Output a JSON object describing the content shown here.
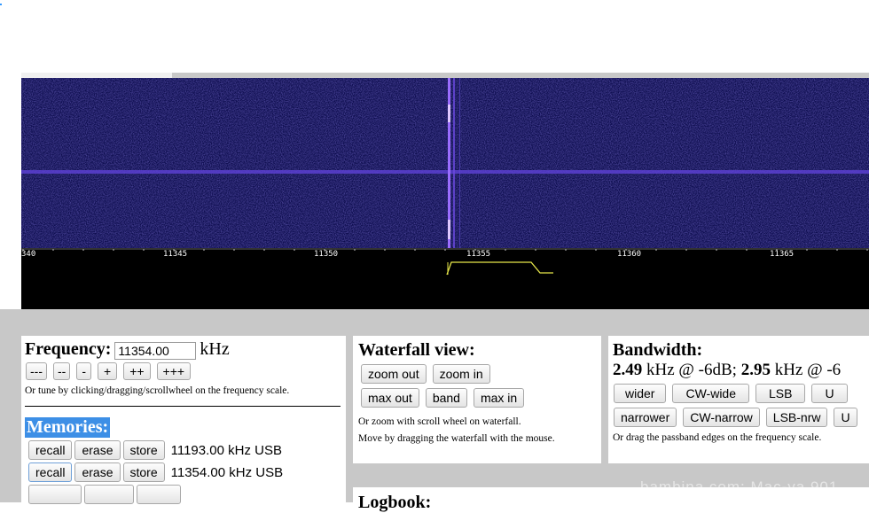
{
  "waterfall_scale": {
    "ticks": [
      "340",
      "11345",
      "11350",
      "11355",
      "11360",
      "11365"
    ],
    "colors": {
      "background": "#0a0a4a",
      "signal": "#9a6cff",
      "passband": "#e8e84a"
    }
  },
  "frequency": {
    "title": "Frequency:",
    "value": "11354.00",
    "unit": "kHz",
    "tune_buttons": [
      "---",
      "--",
      "-",
      "+",
      "++",
      "+++"
    ],
    "hint": "Or tune by clicking/dragging/scrollwheel on the frequency scale."
  },
  "memories": {
    "title": "Memories:",
    "rows": [
      {
        "recall": "recall",
        "erase": "erase",
        "store": "store",
        "value": "11193.00 kHz USB"
      },
      {
        "recall": "recall",
        "erase": "erase",
        "store": "store",
        "value": "11354.00 kHz USB"
      }
    ]
  },
  "waterfall_view": {
    "title": "Waterfall view:",
    "buttons_row1": [
      "zoom out",
      "zoom in"
    ],
    "buttons_row2": [
      "max out",
      "band",
      "max in"
    ],
    "hint1": "Or zoom with scroll wheel on waterfall.",
    "hint2": "Move by dragging the waterfall with the mouse."
  },
  "bandwidth": {
    "title": "Bandwidth:",
    "value1": "2.49",
    "unit1": "kHz @ -6dB;",
    "value2": "2.95",
    "unit2": "kHz @ -6",
    "buttons_row1": [
      "wider",
      "CW-wide",
      "LSB",
      "U"
    ],
    "buttons_row2": [
      "narrower",
      "CW-narrow",
      "LSB-nrw",
      "U"
    ],
    "hint": "Or drag the passband edges on the frequency scale."
  },
  "logbook": {
    "title": "Logbook:"
  },
  "watermark": "bambina.com: Mac-ya.901"
}
